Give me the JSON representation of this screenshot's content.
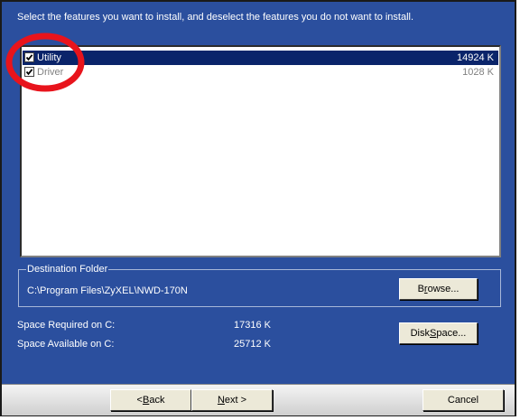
{
  "instruction": "Select the features you want to install, and deselect the features you do not want to install.",
  "features": [
    {
      "name": "Utility",
      "size": "14924 K",
      "checked": true,
      "selected": true
    },
    {
      "name": "Driver",
      "size": "1028 K",
      "checked": true,
      "selected": false
    }
  ],
  "destination": {
    "legend": "Destination Folder",
    "path": "C:\\Program Files\\ZyXEL\\NWD-170N",
    "browse_pre": "B",
    "browse_mnemonic": "r",
    "browse_post": "owse..."
  },
  "space": {
    "required_label": "Space Required on C:",
    "required_value": "17316 K",
    "available_label": "Space Available on C:",
    "available_value": "25712 K"
  },
  "disk_space_button": {
    "pre": "Disk ",
    "mnemonic": "S",
    "post": "pace..."
  },
  "nav": {
    "back_pre": "< ",
    "back_mnemonic": "B",
    "back_post": "ack",
    "next_mnemonic": "N",
    "next_post": "ext >",
    "cancel_label": "Cancel"
  },
  "colors": {
    "dialog_background": "#2b4f9e",
    "selection": "#0a246a",
    "annotation": "#e8141c"
  },
  "icons": {
    "checkbox": "checkmark-icon"
  }
}
